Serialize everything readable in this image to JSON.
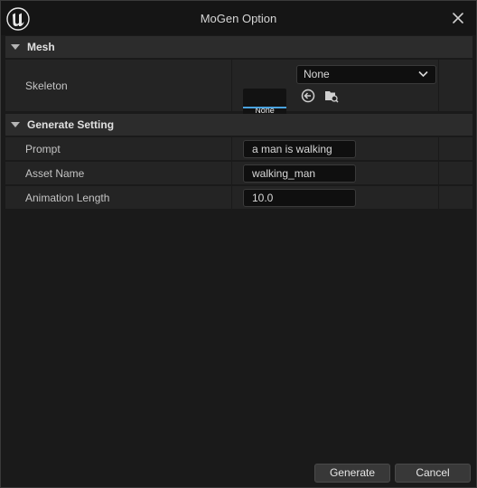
{
  "window": {
    "title": "MoGen Option"
  },
  "mesh_section": {
    "header": "Mesh",
    "skeleton": {
      "label": "Skeleton",
      "thumbnail_text": "None",
      "combo_value": "None"
    }
  },
  "generate_section": {
    "header": "Generate Setting",
    "prompt": {
      "label": "Prompt",
      "value": "a man is walking"
    },
    "asset_name": {
      "label": "Asset Name",
      "value": "walking_man"
    },
    "animation_length": {
      "label": "Animation Length",
      "value": "10.0"
    }
  },
  "footer": {
    "generate_label": "Generate",
    "cancel_label": "Cancel"
  },
  "icons": [
    "unreal-logo-icon",
    "close-icon",
    "chevron-down-icon",
    "browse-back-icon",
    "folder-search-icon"
  ],
  "colors": {
    "accent": "#4aa3df",
    "background": "#1a1a1a",
    "header": "#2c2c2c",
    "row": "#242424"
  }
}
